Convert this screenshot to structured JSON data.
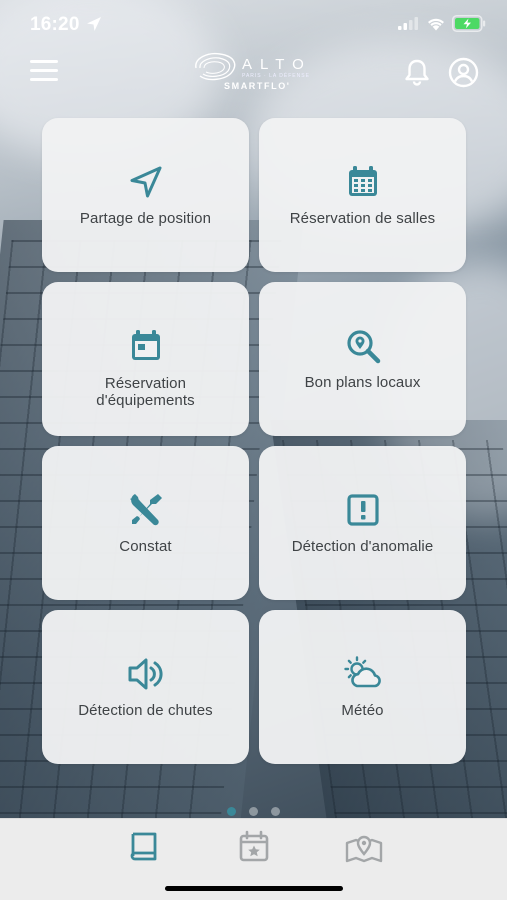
{
  "status_bar": {
    "time": "16:20"
  },
  "header": {
    "logo_text": "ALTO",
    "logo_subtext": "PARIS · LA DÉFENSE",
    "logo_brand": "SMARTFLO'"
  },
  "tiles": [
    {
      "label": "Partage de position",
      "icon": "navigation-arrow-icon"
    },
    {
      "label": "Réservation de salles",
      "icon": "calendar-grid-icon"
    },
    {
      "label": "Réservation\nd'équipements",
      "icon": "calendar-day-icon"
    },
    {
      "label": "Bon plans locaux",
      "icon": "search-location-icon"
    },
    {
      "label": "Constat",
      "icon": "tools-icon"
    },
    {
      "label": "Détection d'anomalie",
      "icon": "alert-square-icon"
    },
    {
      "label": "Détection de chutes",
      "icon": "speaker-icon"
    },
    {
      "label": "Météo",
      "icon": "weather-icon"
    }
  ],
  "pagination": {
    "pages": 3,
    "active": 1
  },
  "tabbar": {
    "tabs": [
      {
        "icon": "book-icon",
        "active": true
      },
      {
        "icon": "calendar-star-icon",
        "active": false
      },
      {
        "icon": "map-pin-icon",
        "active": false
      }
    ]
  },
  "colors": {
    "accent": "#3a8898",
    "tile_bg": "#f0f1f2",
    "tile_text": "#3f4346",
    "tab_inactive": "#a3a6a8"
  }
}
